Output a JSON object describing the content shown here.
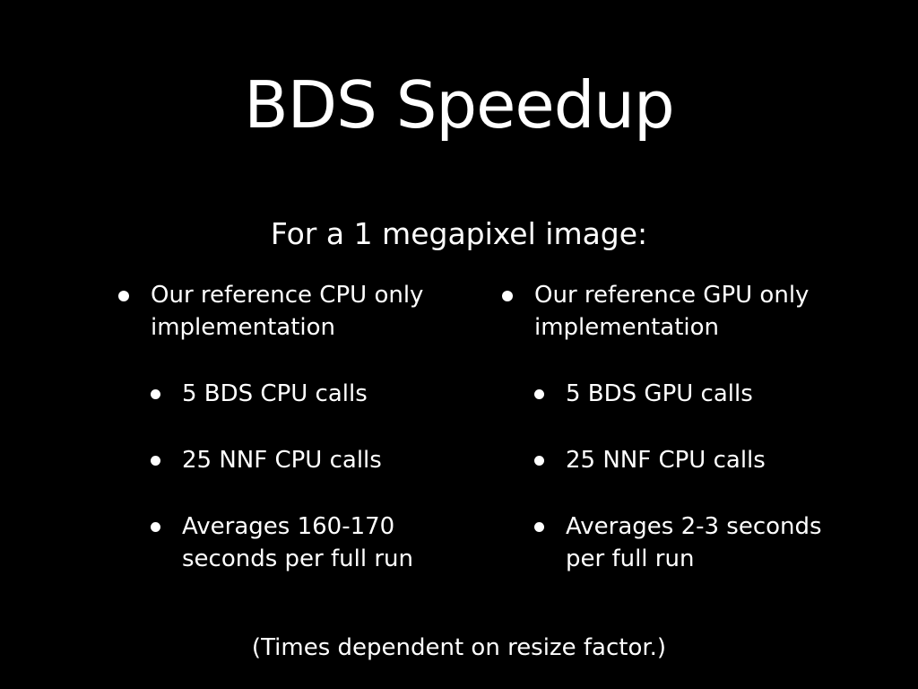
{
  "slide": {
    "title": "BDS Speedup",
    "subtitle": "For a 1 megapixel image:",
    "footnote": "(Times dependent on resize factor.)",
    "columns": [
      {
        "heading_line1": "Our reference CPU only",
        "heading_line2": "implementation",
        "items": [
          {
            "line1": "5 BDS CPU calls",
            "line2": ""
          },
          {
            "line1": "25 NNF CPU calls",
            "line2": ""
          },
          {
            "line1": "Averages 160-170",
            "line2": "seconds per full run"
          }
        ]
      },
      {
        "heading_line1": "Our reference GPU only",
        "heading_line2": "implementation",
        "items": [
          {
            "line1": "5 BDS GPU calls",
            "line2": ""
          },
          {
            "line1": "25 NNF CPU calls",
            "line2": ""
          },
          {
            "line1": "Averages 2-3 seconds",
            "line2": "per full run"
          }
        ]
      }
    ]
  }
}
